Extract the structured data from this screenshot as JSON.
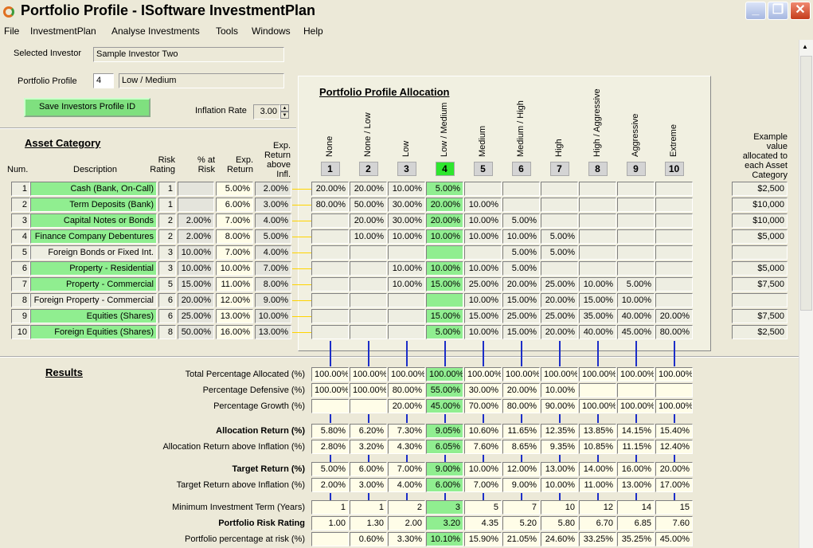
{
  "window": {
    "title": "Portfolio Profile - ISoftware InvestmentPlan"
  },
  "menu": [
    "File",
    "InvestmentPlan",
    "Analyse Investments",
    "Tools",
    "Windows",
    "Help"
  ],
  "investor": {
    "selected_label": "Selected Investor",
    "selected_value": "Sample Investor Two",
    "profile_label": "Portfolio Profile",
    "profile_num": "4",
    "profile_name": "Low / Medium",
    "save_button": "Save Investors Profile ID",
    "inflation_label": "Inflation Rate",
    "inflation_value": "3.00"
  },
  "allocation": {
    "title": "Portfolio Profile Allocation",
    "profiles": [
      "None",
      "None / Low",
      "Low",
      "Low / Medium",
      "Medium",
      "Medium / High",
      "High",
      "High / Aggressive",
      "Aggressive",
      "Extreme"
    ],
    "numbers": [
      "1",
      "2",
      "3",
      "4",
      "5",
      "6",
      "7",
      "8",
      "9",
      "10"
    ],
    "selected_index": 3
  },
  "asset": {
    "title": "Asset Category",
    "headers": {
      "num": "Num.",
      "desc": "Description",
      "risk": "Risk Rating",
      "pct": "% at Risk",
      "exp": "Exp. Return",
      "above": "Exp. Return above Infl."
    },
    "example_header": "Example value allocated to each Asset Category",
    "rows": [
      {
        "num": "1",
        "desc": "Cash (Bank, On-Call)",
        "risk": "1",
        "pct": "",
        "exp": "5.00%",
        "above": "2.00%",
        "alloc": [
          "20.00%",
          "20.00%",
          "10.00%",
          "5.00%",
          "",
          "",
          "",
          "",
          "",
          ""
        ],
        "example": "$2,500",
        "green": true
      },
      {
        "num": "2",
        "desc": "Term Deposits (Bank)",
        "risk": "1",
        "pct": "",
        "exp": "6.00%",
        "above": "3.00%",
        "alloc": [
          "80.00%",
          "50.00%",
          "30.00%",
          "20.00%",
          "10.00%",
          "",
          "",
          "",
          "",
          ""
        ],
        "example": "$10,000",
        "green": true
      },
      {
        "num": "3",
        "desc": "Capital Notes or Bonds",
        "risk": "2",
        "pct": "2.00%",
        "exp": "7.00%",
        "above": "4.00%",
        "alloc": [
          "",
          "20.00%",
          "30.00%",
          "20.00%",
          "10.00%",
          "5.00%",
          "",
          "",
          "",
          ""
        ],
        "example": "$10,000",
        "green": true
      },
      {
        "num": "4",
        "desc": "Finance Company Debentures",
        "risk": "2",
        "pct": "2.00%",
        "exp": "8.00%",
        "above": "5.00%",
        "alloc": [
          "",
          "10.00%",
          "10.00%",
          "10.00%",
          "10.00%",
          "10.00%",
          "5.00%",
          "",
          "",
          ""
        ],
        "example": "$5,000",
        "green": true
      },
      {
        "num": "5",
        "desc": "Foreign Bonds or Fixed Int.",
        "risk": "3",
        "pct": "10.00%",
        "exp": "7.00%",
        "above": "4.00%",
        "alloc": [
          "",
          "",
          "",
          "",
          "",
          "5.00%",
          "5.00%",
          "",
          "",
          ""
        ],
        "example": "",
        "green": false
      },
      {
        "num": "6",
        "desc": "Property - Residential",
        "risk": "3",
        "pct": "10.00%",
        "exp": "10.00%",
        "above": "7.00%",
        "alloc": [
          "",
          "",
          "10.00%",
          "10.00%",
          "10.00%",
          "5.00%",
          "",
          "",
          "",
          ""
        ],
        "example": "$5,000",
        "green": true
      },
      {
        "num": "7",
        "desc": "Property - Commercial",
        "risk": "5",
        "pct": "15.00%",
        "exp": "11.00%",
        "above": "8.00%",
        "alloc": [
          "",
          "",
          "10.00%",
          "15.00%",
          "25.00%",
          "20.00%",
          "25.00%",
          "10.00%",
          "5.00%",
          ""
        ],
        "example": "$7,500",
        "green": true
      },
      {
        "num": "8",
        "desc": "Foreign Property - Commercial",
        "risk": "6",
        "pct": "20.00%",
        "exp": "12.00%",
        "above": "9.00%",
        "alloc": [
          "",
          "",
          "",
          "",
          "10.00%",
          "15.00%",
          "20.00%",
          "15.00%",
          "10.00%",
          ""
        ],
        "example": "",
        "green": false
      },
      {
        "num": "9",
        "desc": "Equities (Shares)",
        "risk": "6",
        "pct": "25.00%",
        "exp": "13.00%",
        "above": "10.00%",
        "alloc": [
          "",
          "",
          "",
          "15.00%",
          "15.00%",
          "25.00%",
          "25.00%",
          "35.00%",
          "40.00%",
          "20.00%"
        ],
        "example": "$7,500",
        "green": true
      },
      {
        "num": "10",
        "desc": "Foreign Equities (Shares)",
        "risk": "8",
        "pct": "50.00%",
        "exp": "16.00%",
        "above": "13.00%",
        "alloc": [
          "",
          "",
          "",
          "5.00%",
          "10.00%",
          "15.00%",
          "20.00%",
          "40.00%",
          "45.00%",
          "80.00%"
        ],
        "example": "$2,500",
        "green": true
      }
    ]
  },
  "results": {
    "title": "Results",
    "rows": [
      {
        "label": "Total Percentage Allocated (%)",
        "bold": false,
        "values": [
          "100.00%",
          "100.00%",
          "100.00%",
          "100.00%",
          "100.00%",
          "100.00%",
          "100.00%",
          "100.00%",
          "100.00%",
          "100.00%"
        ]
      },
      {
        "label": "Percentage Defensive (%)",
        "bold": false,
        "values": [
          "100.00%",
          "100.00%",
          "80.00%",
          "55.00%",
          "30.00%",
          "20.00%",
          "10.00%",
          "",
          "",
          ""
        ]
      },
      {
        "label": "Percentage Growth (%)",
        "bold": false,
        "values": [
          "",
          "",
          "20.00%",
          "45.00%",
          "70.00%",
          "80.00%",
          "90.00%",
          "100.00%",
          "100.00%",
          "100.00%"
        ]
      },
      {
        "label": "Allocation Return (%)",
        "bold": true,
        "values": [
          "5.80%",
          "6.20%",
          "7.30%",
          "9.05%",
          "10.60%",
          "11.65%",
          "12.35%",
          "13.85%",
          "14.15%",
          "15.40%"
        ]
      },
      {
        "label": "Allocation Return above Inflation (%)",
        "bold": false,
        "values": [
          "2.80%",
          "3.20%",
          "4.30%",
          "6.05%",
          "7.60%",
          "8.65%",
          "9.35%",
          "10.85%",
          "11.15%",
          "12.40%"
        ]
      },
      {
        "label": "Target Return (%)",
        "bold": true,
        "values": [
          "5.00%",
          "6.00%",
          "7.00%",
          "9.00%",
          "10.00%",
          "12.00%",
          "13.00%",
          "14.00%",
          "16.00%",
          "20.00%"
        ]
      },
      {
        "label": "Target Return above Inflation (%)",
        "bold": false,
        "values": [
          "2.00%",
          "3.00%",
          "4.00%",
          "6.00%",
          "7.00%",
          "9.00%",
          "10.00%",
          "11.00%",
          "13.00%",
          "17.00%"
        ]
      },
      {
        "label": "Minimum Investment Term (Years)",
        "bold": false,
        "values": [
          "1",
          "1",
          "2",
          "3",
          "5",
          "7",
          "10",
          "12",
          "14",
          "15"
        ]
      },
      {
        "label": "Portfolio Risk Rating",
        "bold": true,
        "values": [
          "1.00",
          "1.30",
          "2.00",
          "3.20",
          "4.35",
          "5.20",
          "5.80",
          "6.70",
          "6.85",
          "7.60"
        ]
      },
      {
        "label": "Portfolio percentage at risk (%)",
        "bold": false,
        "values": [
          "",
          "0.60%",
          "3.30%",
          "10.10%",
          "15.90%",
          "21.05%",
          "24.60%",
          "33.25%",
          "35.25%",
          "45.00%"
        ]
      }
    ]
  },
  "colors": {
    "green": "#90ee90",
    "selected": "#2ee62e",
    "link_line": "#ffd400",
    "blue_line": "#1c2ec8"
  }
}
